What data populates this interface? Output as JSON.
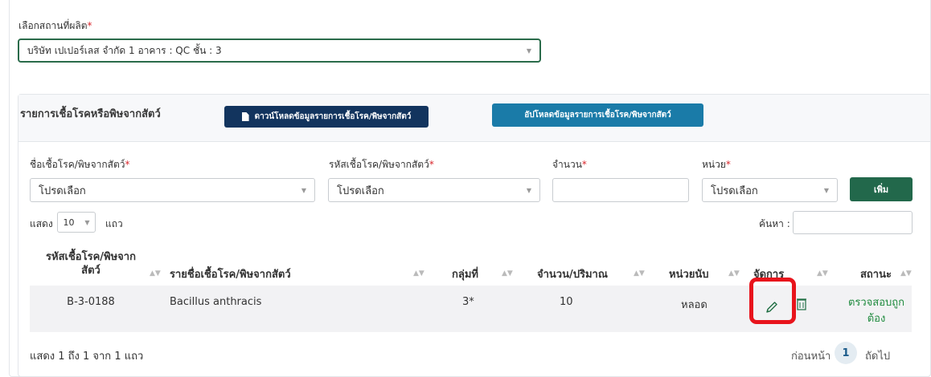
{
  "production_site": {
    "label": "เลือกสถานที่ผลิต",
    "required_mark": "*",
    "selected": "บริษัท เปเปอร์เลส จำกัด 1 อาคาร : QC ชั้น : 3"
  },
  "pathogen_section": {
    "title": "รายการเชื้อโรคหรือพิษจากสัตว์",
    "download_button": "ดาวน์โหลดข้อมูลรายการเชื้อโรค/พิษจากสัตว์",
    "upload_button": "อัปโหลดข้อมูลรายการเชื้อโรค/พิษจากสัตว์"
  },
  "form": {
    "name_label": "ชื่อเชื้อโรค/พิษจากสัตว์",
    "name_placeholder": "โปรดเลือก",
    "code_label": "รหัสเชื้อโรค/พิษจากสัตว์",
    "code_placeholder": "โปรดเลือก",
    "quantity_label": "จำนวน",
    "quantity_value": "",
    "unit_label": "หน่วย",
    "unit_placeholder": "โปรดเลือก",
    "required_mark": "*",
    "add_button": "เพิ่ม"
  },
  "table_controls": {
    "show_label": "แสดง",
    "page_length": "10",
    "rows_label": "แถว",
    "search_label": "ค้นหา :",
    "search_value": ""
  },
  "table": {
    "headers": {
      "code_line1": "รหัสเชื้อโรค/พิษจาก",
      "code_line2": "สัตว์",
      "name": "รายชื่อเชื้อโรค/พิษจากสัตว์",
      "group": "กลุ่มที่",
      "quantity": "จำนวน/ปริมาณ",
      "unit": "หน่วยนับ",
      "actions": "จัดการ",
      "status": "สถานะ"
    },
    "rows": [
      {
        "code": "B-3-0188",
        "name": "Bacillus anthracis",
        "group": "3*",
        "quantity": "10",
        "unit": "หลอด",
        "status": "ตรวจสอบถูกต้อง"
      }
    ]
  },
  "footer": {
    "info": "แสดง 1 ถึง 1 จาก 1 แถว",
    "prev": "ก่อนหน้า",
    "current_page": "1",
    "next": "ถัดไป"
  },
  "colors": {
    "download_button": "#12345e",
    "upload_button": "#1a7ba8",
    "add_button": "#22684b",
    "required": "#d9262c",
    "status_ok": "#1e8a3d",
    "highlight": "#e8141c"
  },
  "icons": [
    "document-icon",
    "chevron-down-icon",
    "sort-icon",
    "pencil-icon",
    "trash-icon"
  ]
}
